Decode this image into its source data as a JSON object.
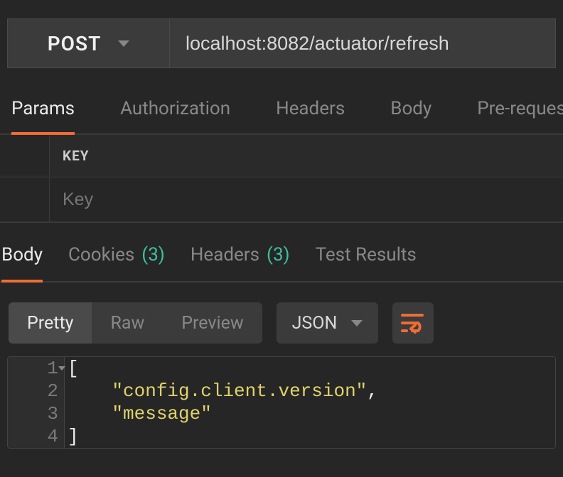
{
  "request": {
    "method": "POST",
    "url": "localhost:8082/actuator/refresh"
  },
  "requestTabs": {
    "params": "Params",
    "authorization": "Authorization",
    "headers": "Headers",
    "body": "Body",
    "prerequest": "Pre-request S"
  },
  "paramsTable": {
    "header_key": "KEY",
    "placeholder_key": "Key"
  },
  "responseTabs": {
    "body": "Body",
    "cookies": "Cookies",
    "cookies_count": "(3)",
    "headers": "Headers",
    "headers_count": "(3)",
    "testresults": "Test Results"
  },
  "viewModes": {
    "pretty": "Pretty",
    "raw": "Raw",
    "preview": "Preview"
  },
  "formatSelect": "JSON",
  "responseBody": {
    "ln1": "1",
    "ln2": "2",
    "ln3": "3",
    "ln4": "4",
    "bracket_open": "[",
    "bracket_close": "]",
    "item1": "\"config.client.version\"",
    "comma": ",",
    "item2": "\"message\""
  }
}
